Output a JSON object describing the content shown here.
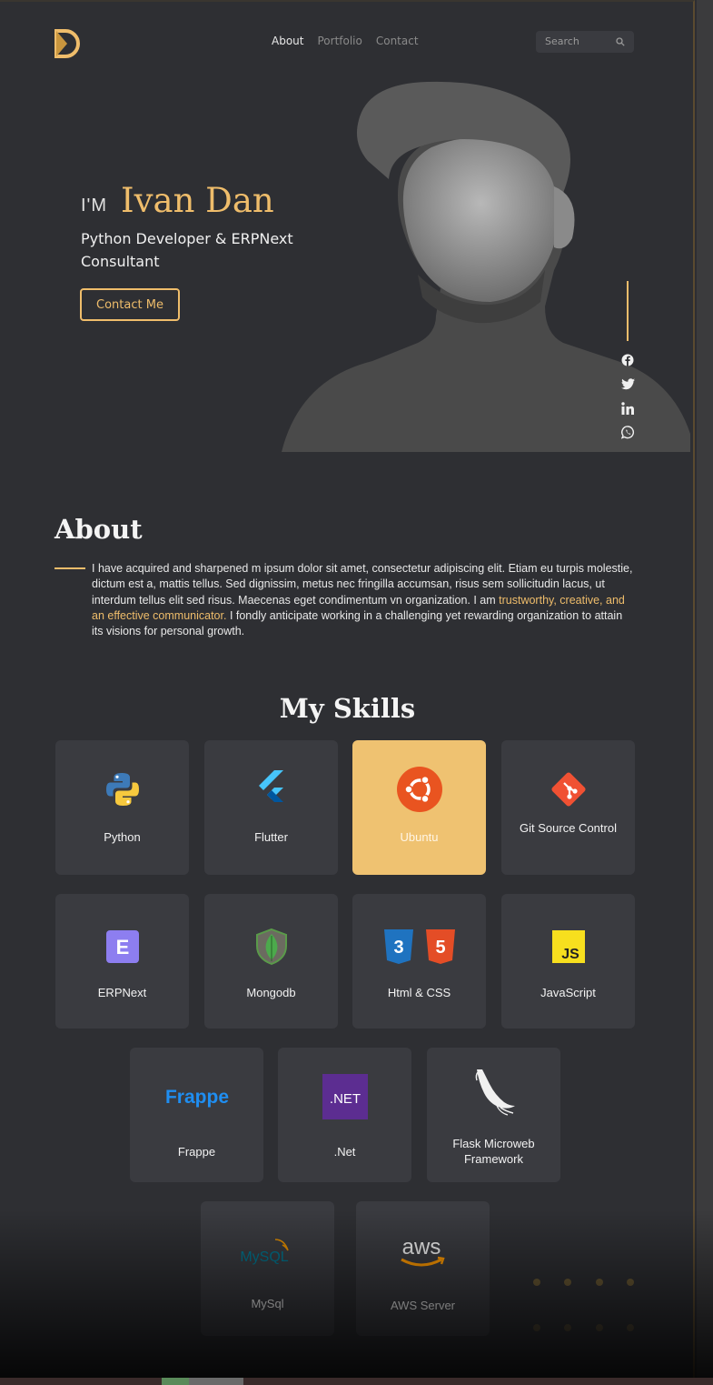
{
  "nav": {
    "items": [
      "About",
      "Portfolio",
      "Contact"
    ],
    "active_index": 0
  },
  "search": {
    "placeholder": "Search"
  },
  "hero": {
    "greeting": "I'M",
    "name": "Ivan Dan",
    "role": "Python Developer & ERPNext Consultant",
    "cta": "Contact Me",
    "social_icons": [
      "facebook-icon",
      "twitter-icon",
      "linkedin-icon",
      "whatsapp-icon"
    ]
  },
  "about": {
    "title": "About",
    "text_before": "I have acquired and sharpened m ipsum dolor sit amet, consectetur adipiscing elit. Etiam eu turpis molestie, dictum est a, mattis tellus. Sed dignissim, metus nec fringilla accumsan, risus sem sollicitudin lacus, ut interdum tellus elit sed risus. Maecenas eget condimentum vn organization. I am ",
    "highlight": "trustworthy, creative, and an effective communicator.",
    "text_after": " I fondly anticipate working in a challenging yet rewarding organization to attain its visions for personal growth."
  },
  "skills": {
    "title": "My Skills",
    "items": [
      {
        "label": "Python",
        "icon": "python-icon",
        "selected": false
      },
      {
        "label": "Flutter",
        "icon": "flutter-icon",
        "selected": false
      },
      {
        "label": "Ubuntu",
        "icon": "ubuntu-icon",
        "selected": true
      },
      {
        "label": "Git Source Control",
        "icon": "git-icon",
        "selected": false
      },
      {
        "label": "ERPNext",
        "icon": "erpnext-icon",
        "selected": false
      },
      {
        "label": "Mongodb",
        "icon": "mongodb-icon",
        "selected": false
      },
      {
        "label": "Html & CSS",
        "icon": "html-css-icon",
        "selected": false,
        "icon_text": [
          "3",
          "5"
        ]
      },
      {
        "label": "JavaScript",
        "icon": "javascript-icon",
        "selected": false,
        "icon_text": "JS"
      },
      {
        "label": "Frappe",
        "icon": "frappe-icon",
        "selected": false,
        "icon_text": "Frappe"
      },
      {
        "label": ".Net",
        "icon": "dotnet-icon",
        "selected": false,
        "icon_text": ".NET"
      },
      {
        "label": "Flask Microweb Framework",
        "icon": "flask-icon",
        "selected": false
      },
      {
        "label": "MySql",
        "icon": "mysql-icon",
        "selected": false,
        "icon_text": "MySQL"
      },
      {
        "label": "AWS Server",
        "icon": "aws-icon",
        "selected": false,
        "icon_text": "aws"
      }
    ]
  },
  "colors": {
    "accent": "#efbd6b",
    "background": "#2e2f33",
    "card": "#3a3b40",
    "card_selected": "#efc271"
  }
}
